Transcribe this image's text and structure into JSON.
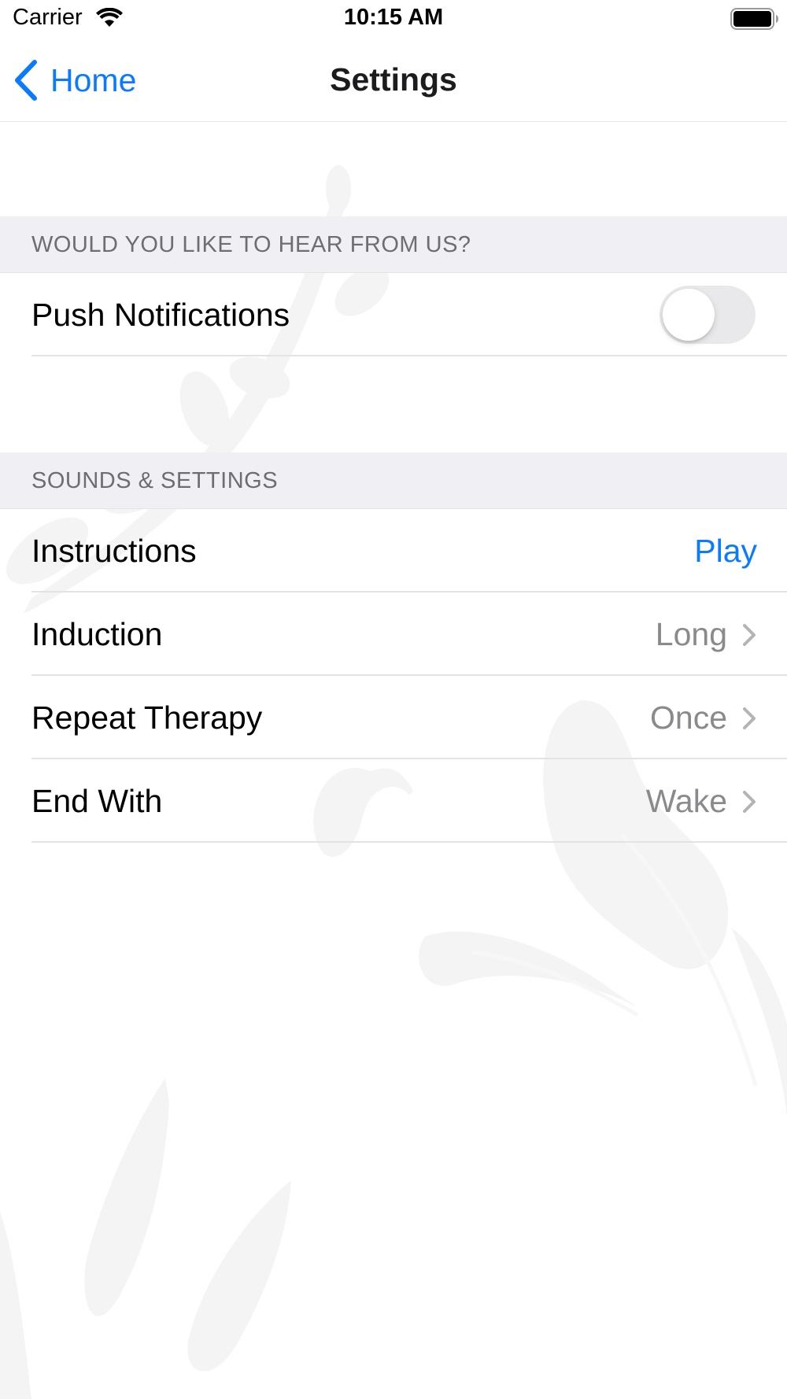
{
  "status_bar": {
    "carrier": "Carrier",
    "time": "10:15 AM",
    "wifi_icon": "wifi-icon",
    "battery_icon": "battery-full-icon"
  },
  "nav": {
    "back_label": "Home",
    "back_icon": "chevron-left-icon",
    "title": "Settings"
  },
  "sections": {
    "notifications": {
      "header": "WOULD YOU LIKE TO HEAR FROM US?",
      "push_label": "Push Notifications",
      "push_enabled": false
    },
    "sounds": {
      "header": "SOUNDS & SETTINGS",
      "instructions_label": "Instructions",
      "instructions_action": "Play",
      "induction_label": "Induction",
      "induction_value": "Long",
      "repeat_label": "Repeat Therapy",
      "repeat_value": "Once",
      "end_label": "End With",
      "end_value": "Wake"
    }
  },
  "colors": {
    "accent": "#0a7aff",
    "section_bg": "#efeff4",
    "secondary_text": "#8a8a8e"
  }
}
